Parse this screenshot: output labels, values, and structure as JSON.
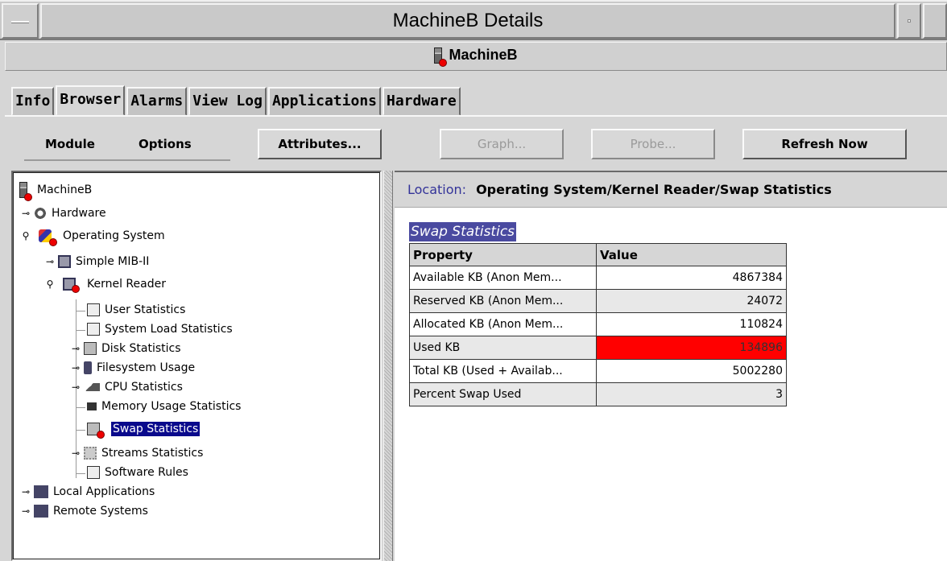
{
  "window": {
    "title": "MachineB Details"
  },
  "header": {
    "machine_name": "MachineB"
  },
  "tabs": [
    "Info",
    "Browser",
    "Alarms",
    "View Log",
    "Applications",
    "Hardware"
  ],
  "toolbar": {
    "module": "Module",
    "options": "Options",
    "attributes": "Attributes...",
    "graph": "Graph...",
    "probe": "Probe...",
    "refresh": "Refresh Now"
  },
  "tree": {
    "root": "MachineB",
    "hardware": "Hardware",
    "operating_system": "Operating System",
    "simple_mib": "Simple MIB-II",
    "kernel_reader": "Kernel Reader",
    "user_statistics": "User Statistics",
    "system_load_statistics": "System Load Statistics",
    "disk_statistics": "Disk Statistics",
    "filesystem_usage": "Filesystem Usage",
    "cpu_statistics": "CPU Statistics",
    "memory_usage_statistics": "Memory Usage Statistics",
    "swap_statistics": "Swap Statistics",
    "streams_statistics": "Streams Statistics",
    "software_rules": "Software Rules",
    "local_applications": "Local Applications",
    "remote_systems": "Remote Systems"
  },
  "location": {
    "label": "Location:",
    "path": "Operating System/Kernel Reader/Swap Statistics"
  },
  "table": {
    "title": "Swap Statistics",
    "columns": [
      "Property",
      "Value"
    ],
    "rows": [
      {
        "property": "Available KB (Anon Mem...",
        "value": "4867384"
      },
      {
        "property": "Reserved KB (Anon Mem...",
        "value": "24072"
      },
      {
        "property": "Allocated KB (Anon Mem...",
        "value": "110824"
      },
      {
        "property": "Used KB",
        "value": "134896"
      },
      {
        "property": "Total KB (Used + Availab...",
        "value": "5002280"
      },
      {
        "property": "Percent Swap Used",
        "value": "3"
      }
    ]
  },
  "colors": {
    "alarm_cell": "#ff0000",
    "selection": "#0a0a8c",
    "location_label": "#333399"
  }
}
